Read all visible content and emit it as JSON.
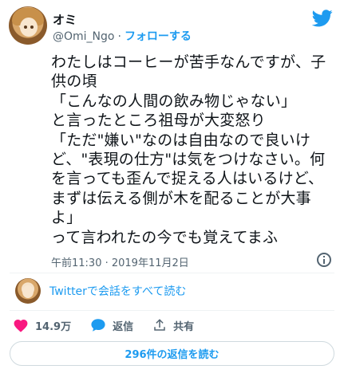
{
  "user": {
    "display_name": "オミ",
    "handle": "@Omi_Ngo",
    "separator": "·",
    "follow_label": "フォローする"
  },
  "tweet": {
    "text": "わたしはコーヒーが苦手なんですが、子\n供の頃\n「こんなの人間の飲み物じゃない」\nと言ったところ祖母が大変怒り\n「ただ\"嫌い\"なのは自由なので良いけ\nど、\"表現の仕方\"は気をつけなさい。何\nを言っても歪んで捉える人はいるけど、\nまずは伝える側が木を配ることが大事\nよ」\nって言われたの今でも覚えてまふ",
    "timestamp": "午前11:30 · 2019年11月2日"
  },
  "conversation": {
    "link_label": "Twitterで会話をすべて読む"
  },
  "actions": {
    "like_count": "14.9万",
    "reply_label": "返信",
    "share_label": "共有"
  },
  "replies_button_label": "296件の返信を読む",
  "colors": {
    "brand_blue": "#1d9bf0",
    "like_red": "#f91880",
    "secondary_text": "#536471"
  },
  "icons": [
    "twitter-bird-icon",
    "info-icon",
    "heart-icon",
    "reply-bubble-icon",
    "share-icon"
  ]
}
